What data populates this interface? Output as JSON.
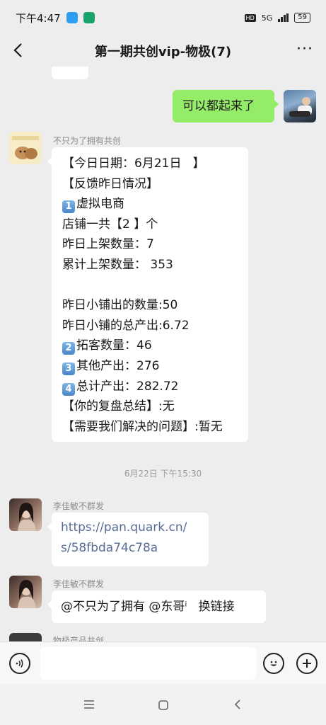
{
  "status_bar": {
    "time": "下午4:47",
    "network": "5G",
    "hd": "HD",
    "battery": "59"
  },
  "nav": {
    "title": "第一期共创vip-物极(7)"
  },
  "messages": {
    "self_msg": "可以都起来了",
    "report": {
      "sender": "不只为了拥有共创",
      "lines": {
        "l1": "【今日日期：6月21日   】",
        "l2": "【反馈昨日情况】",
        "l3_badge": "1",
        "l3": "虚拟电商",
        "l4": "店铺一共【2 】个",
        "l5": "昨日上架数量：7",
        "l6": "累计上架数量： 353",
        "l7": "昨日小铺出的数量:50",
        "l8": "昨日小铺的总产出:6.72",
        "l9_badge": "2",
        "l9": "拓客数量：46",
        "l10_badge": "3",
        "l10": "其他产出：276",
        "l11_badge": "4",
        "l11": "总计产出：282.72",
        "l12": "【你的复盘总结】:无",
        "l13": "【需要我们解决的问题】:暂无"
      }
    },
    "timestamp": "6月22日 下午15:30",
    "link_msg": {
      "sender": "李佳敏不群发",
      "line1": "https://pan.quark.cn/",
      "line2": "s/58fbda74c78a"
    },
    "mention_msg": {
      "sender": "李佳敏不群发",
      "text": "@不只为了拥有 @东哥ⁱ   换链接"
    },
    "partial_sender": "物极产品共创"
  },
  "colors": {
    "self_bubble": "#95ec69",
    "link": "#576b95",
    "background": "#ededed"
  },
  "icons": {
    "voice": "voice-icon",
    "emoji": "emoji-icon",
    "plus": "plus-icon",
    "back": "back-arrow-icon",
    "more": "more-icon"
  }
}
